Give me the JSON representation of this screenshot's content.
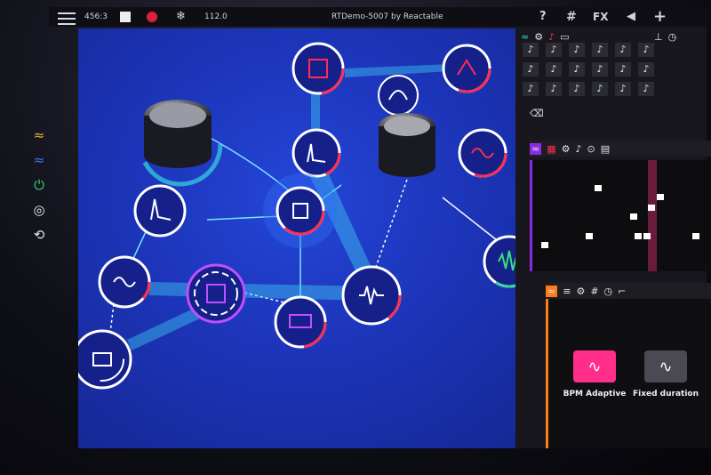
{
  "topbar": {
    "tempo_display": "456:3",
    "bpm": "112.0",
    "title": "RTDemo-5007 by Reactable",
    "help_label": "?",
    "grid_label": "#",
    "fx_label": "FX",
    "add_label": "+"
  },
  "panel": {
    "notes": [
      "♪",
      "♪",
      "♪",
      "♪",
      "♪",
      "♪",
      "♪",
      "♪",
      "♪",
      "♪",
      "♪",
      "♪",
      "♪",
      "♪",
      "♪",
      "♪",
      "♪",
      "♪"
    ],
    "seq_tabs": [
      "#",
      "⊙",
      "♪"
    ],
    "sample_buttons": [
      {
        "label": "BPM Adaptive",
        "color": "#ff2e8a"
      },
      {
        "label": "Fixed duration",
        "color": "#4a4a52"
      }
    ]
  },
  "colors": {
    "accent_red": "#ff2d4f",
    "accent_cyan": "#36d6e0",
    "stage_blue": "#1f3bd0",
    "sample_orange": "#ff7a1a",
    "sequencer_purple": "#8a2be2",
    "pink": "#ff2e8a"
  }
}
